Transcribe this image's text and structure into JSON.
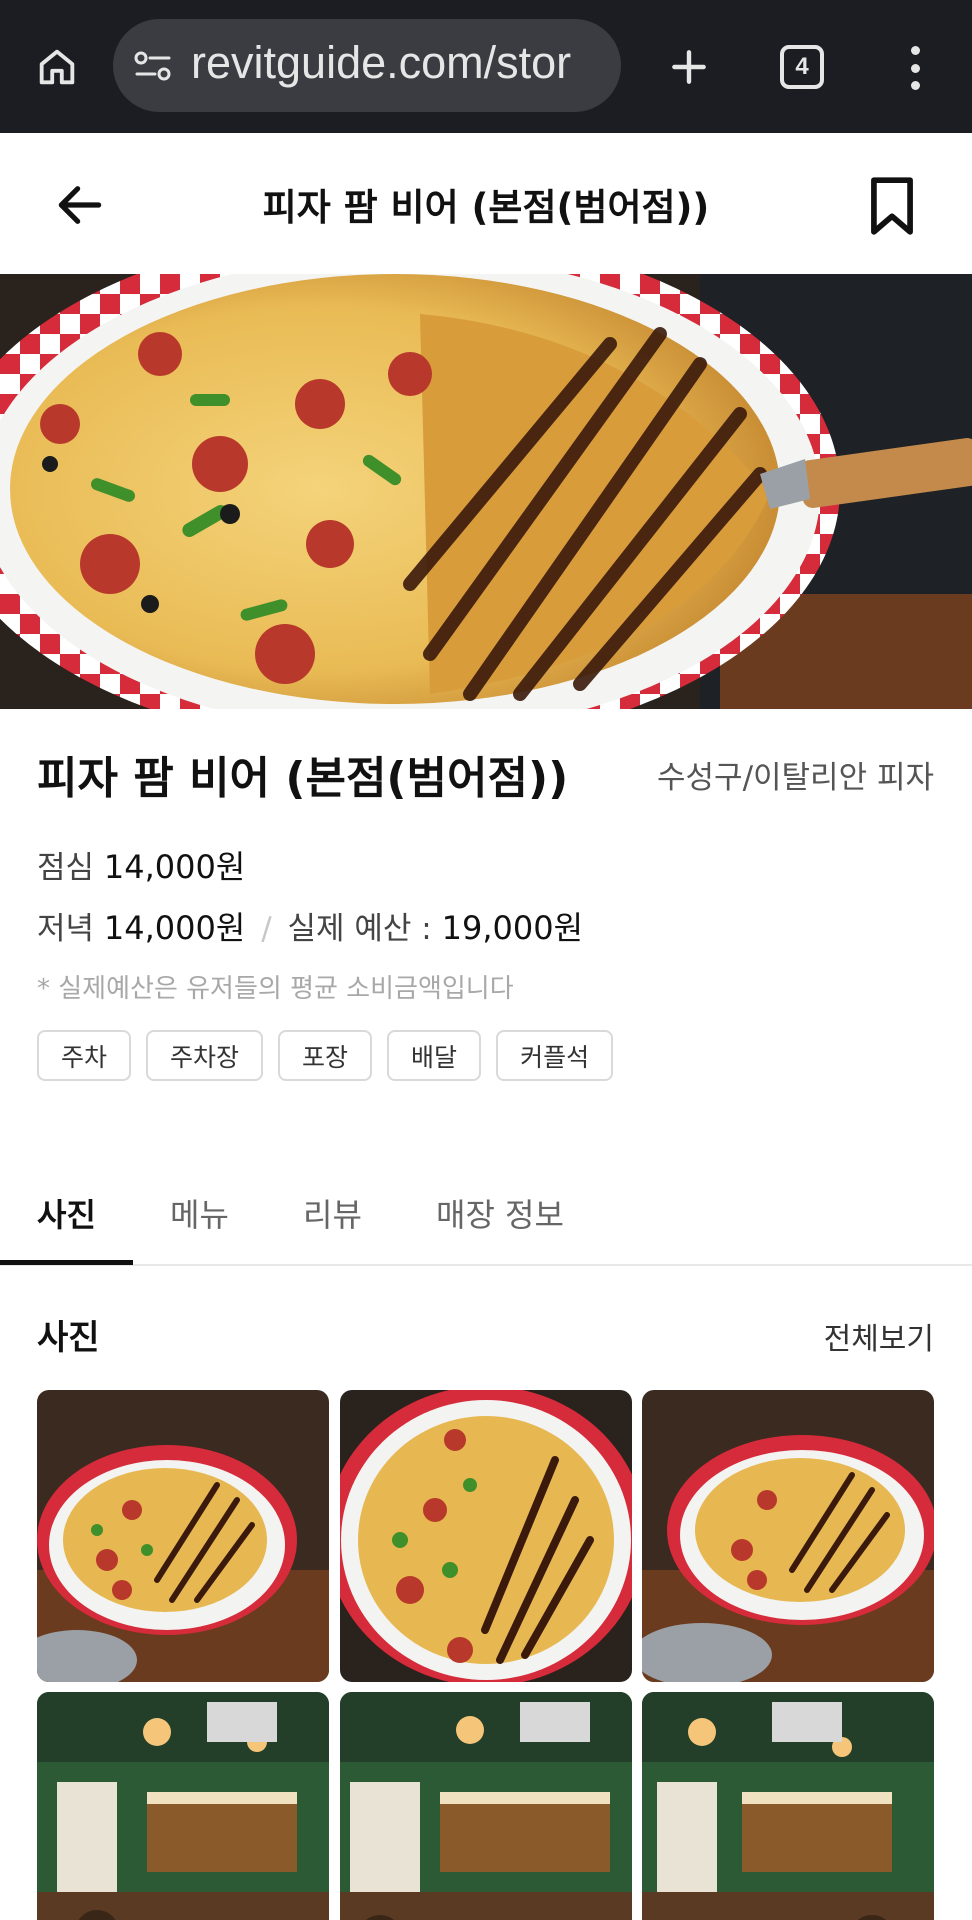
{
  "browser": {
    "url": "revitguide.com/stor",
    "tab_count": "4",
    "icons": [
      "home-icon",
      "site-settings-icon",
      "plus-icon",
      "tab-switcher-icon",
      "more-vert-icon"
    ]
  },
  "header": {
    "title": "피자 팜 비어 (본점(범어점))",
    "icons": [
      "back-arrow-icon",
      "bookmark-icon"
    ]
  },
  "store": {
    "name": "피자 팜 비어 (본점(범어점))",
    "category": "수성구/이탈리안 피자",
    "lunch_label": "점심",
    "lunch_price": "14,000원",
    "dinner_label": "저녁",
    "dinner_price": "14,000원",
    "separator": "/",
    "budget_label": "실제 예산 :",
    "budget_price": "19,000원",
    "budget_note": "* 실제예산은 유저들의 평균 소비금액입니다",
    "tags": [
      "주차",
      "주차장",
      "포장",
      "배달",
      "커플석"
    ]
  },
  "tabs": [
    {
      "label": "사진",
      "active": true
    },
    {
      "label": "메뉴",
      "active": false
    },
    {
      "label": "리뷰",
      "active": false
    },
    {
      "label": "매장 정보",
      "active": false
    }
  ],
  "photos_section": {
    "title": "사진",
    "view_all": "전체보기"
  },
  "colors": {
    "browser_bg": "#1b1d22",
    "url_pill": "#3a3c42",
    "accent_text": "#111111",
    "tag_border": "#d9d9d9",
    "note_gray": "#a8a8a8"
  }
}
